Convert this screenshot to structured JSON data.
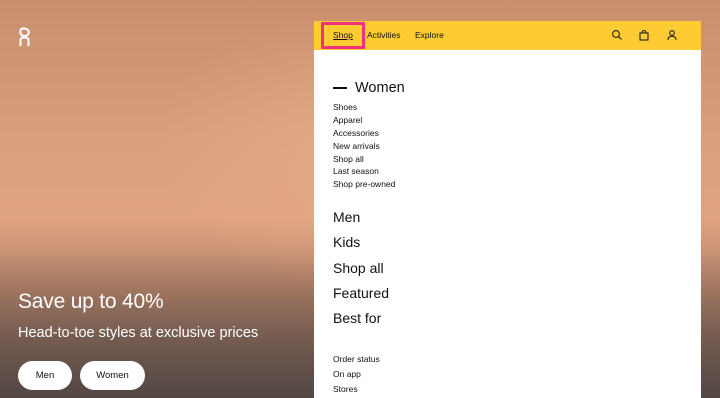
{
  "brand": {
    "logo_icon": "on-logo-icon"
  },
  "hero": {
    "title": "Save up to 40%",
    "subtitle": "Head-to-toe styles at exclusive prices",
    "buttons": [
      {
        "label": "Men"
      },
      {
        "label": "Women"
      }
    ]
  },
  "menu": {
    "nav": [
      {
        "label": "Shop",
        "active": true
      },
      {
        "label": "Activities"
      },
      {
        "label": "Explore"
      }
    ],
    "icons": [
      "search-icon",
      "bag-icon",
      "user-icon"
    ],
    "highlight_color": "#f0327c",
    "bar_color": "#fecb33",
    "section_title": "Women",
    "subitems": [
      "Shoes",
      "Apparel",
      "Accessories",
      "New arrivals",
      "Shop all",
      "Last season",
      "Shop pre-owned"
    ],
    "categories": [
      "Men",
      "Kids",
      "Shop all",
      "Featured",
      "Best for"
    ],
    "utility_links": [
      "Order status",
      "On app",
      "Stores"
    ]
  }
}
